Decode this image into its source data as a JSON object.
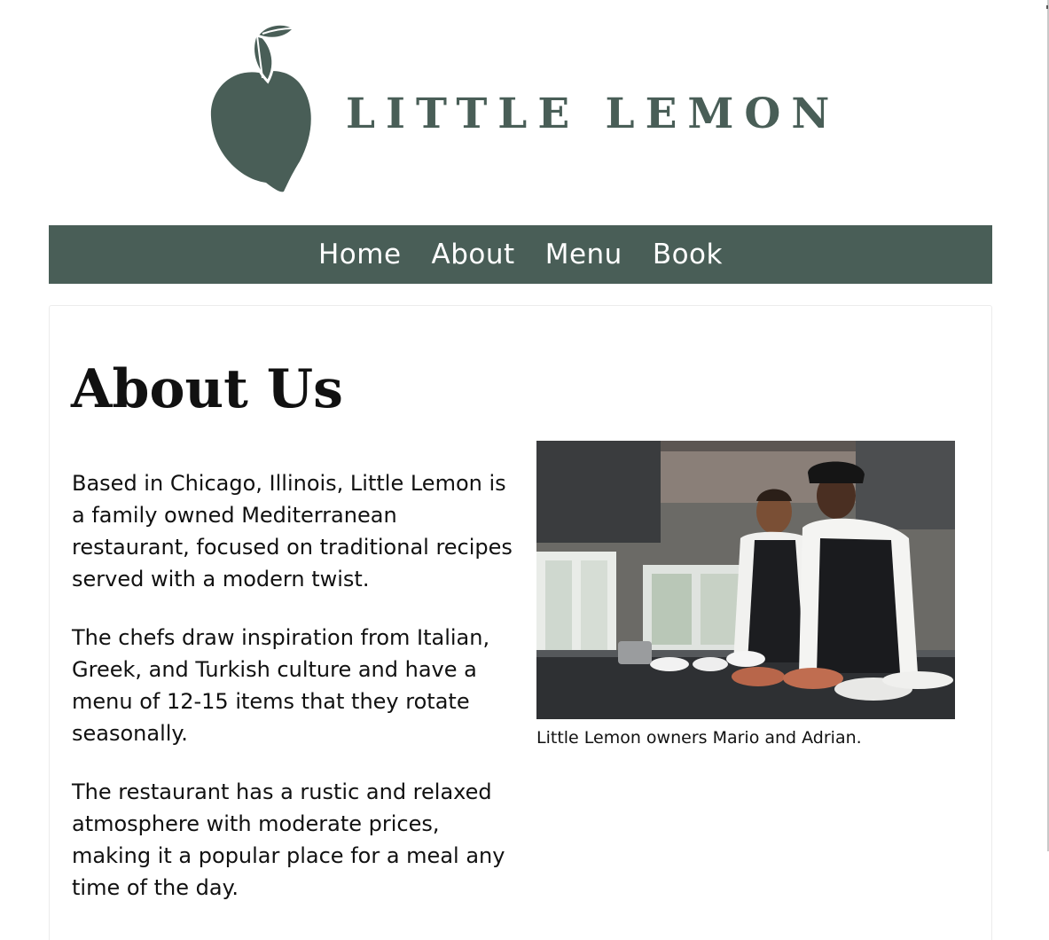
{
  "brand": {
    "name": "LITTLE LEMON",
    "logo_icon": "lemon-leaf-icon",
    "primary_color": "#495e57"
  },
  "nav": {
    "items": [
      {
        "label": "Home"
      },
      {
        "label": "About"
      },
      {
        "label": "Menu"
      },
      {
        "label": "Book"
      }
    ]
  },
  "main": {
    "title": "About Us",
    "paragraphs": [
      "Based in Chicago, Illinois, Little Lemon is a family owned Mediterranean restaurant, focused on traditional recipes served with a modern twist.",
      "The chefs draw inspiration from Italian, Greek, and Turkish culture and have a menu of 12-15 items that they rotate seasonally.",
      "The restaurant has a rustic and relaxed atmosphere with moderate prices, making it a popular place for a meal any time of the day."
    ],
    "figure": {
      "caption": "Little Lemon owners Mario and Adrian."
    }
  }
}
